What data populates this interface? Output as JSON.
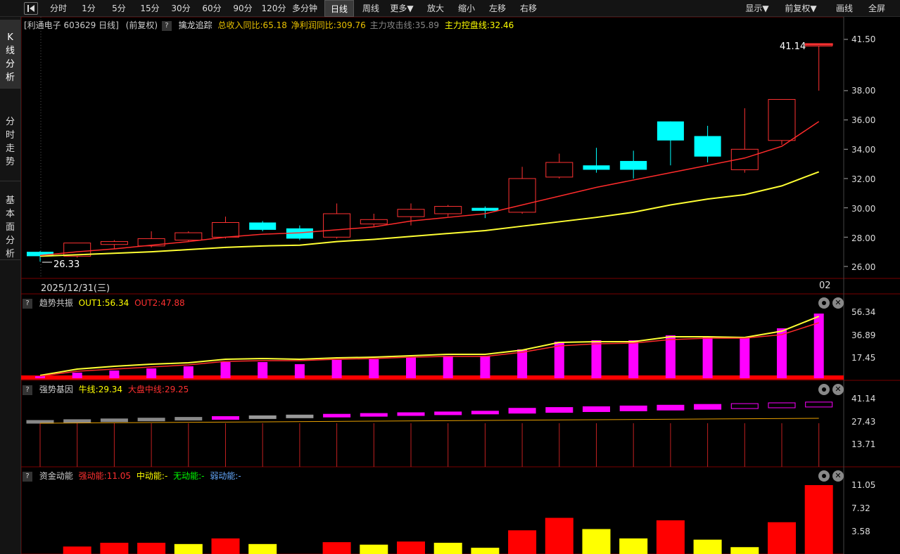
{
  "toolbar": {
    "back_icon": "back-triangle-icon",
    "periods": [
      "分时",
      "1分",
      "5分",
      "15分",
      "30分",
      "60分",
      "90分",
      "120分",
      "多分钟",
      "日线",
      "周线",
      "更多▼",
      "放大",
      "缩小",
      "左移",
      "右移"
    ],
    "active_period": "日线",
    "right_buttons": [
      "显示▼",
      "前复权▼",
      "画线",
      "全屏"
    ]
  },
  "left_tabs": [
    {
      "label": "K线分析",
      "chars": [
        "K",
        "线",
        "分",
        "析"
      ]
    },
    {
      "label": "分时走势",
      "chars": [
        "分",
        "时",
        "走",
        "势"
      ]
    },
    {
      "label": "基本面分析",
      "chars": [
        "基",
        "本",
        "面",
        "分",
        "析"
      ]
    }
  ],
  "main_panel": {
    "stock_label": "[利通电子 603629 日线]",
    "adjust_label": "(前复权)",
    "indicator_name": "擒龙追踪",
    "revenue_yoy": "总收入同比:65.18",
    "profit_yoy": "净利润同比:309.76",
    "attack_line": "主力攻击线:35.89",
    "control_line": "主力控盘线:32.46",
    "high_marker": "41.14",
    "low_marker": "26.33",
    "date_label": "2025/12/31(三)",
    "date_label_right": "02",
    "y_ticks": [
      "41.50",
      "38.00",
      "36.00",
      "34.00",
      "32.00",
      "30.00",
      "28.00",
      "26.00"
    ],
    "y_tick_values": [
      41.5,
      38,
      36,
      34,
      32,
      30,
      28,
      26
    ]
  },
  "trend_panel": {
    "name": "趋势共振",
    "out1": "OUT1:56.34",
    "out2": "OUT2:47.88",
    "y_ticks": [
      "56.34",
      "36.89",
      "17.45"
    ],
    "bars": [
      3,
      8,
      11,
      14,
      17,
      23,
      23,
      20,
      26,
      27,
      30,
      32,
      32,
      41,
      52,
      54,
      54,
      61,
      59,
      58,
      71,
      92
    ],
    "out1_line": [
      4,
      13,
      17,
      20,
      22,
      27,
      28,
      27,
      29,
      30,
      32,
      34,
      34,
      40,
      51,
      52,
      52,
      59,
      59,
      58,
      67,
      88
    ],
    "out2_line": [
      3,
      10,
      13,
      16,
      19,
      24,
      25,
      25,
      27,
      28,
      30,
      31,
      31,
      37,
      46,
      49,
      50,
      55,
      57,
      57,
      62,
      79
    ],
    "bar_scale_max": 100
  },
  "strength_panel": {
    "name": "强势基因",
    "bull_line": "牛线:29.34",
    "market_line": "大盘中线:29.25",
    "y_ticks": [
      "41.14",
      "27.43",
      "13.71"
    ]
  },
  "fund_panel": {
    "name": "资金动能",
    "strong": "强动能:11.05",
    "medium": "中动能:-",
    "none": "无动能:-",
    "weak": "弱动能:-",
    "y_ticks": [
      "11.05",
      "7.32",
      "3.58"
    ],
    "bars": [
      {
        "v": 1.2,
        "c": "red"
      },
      {
        "v": 1.8,
        "c": "red"
      },
      {
        "v": 1.8,
        "c": "red"
      },
      {
        "v": 1.6,
        "c": "yellow"
      },
      {
        "v": 2.5,
        "c": "red"
      },
      {
        "v": 1.6,
        "c": "yellow"
      },
      {
        "v": 0,
        "c": "none"
      },
      {
        "v": 1.9,
        "c": "red"
      },
      {
        "v": 1.5,
        "c": "yellow"
      },
      {
        "v": 2.0,
        "c": "red"
      },
      {
        "v": 1.8,
        "c": "yellow"
      },
      {
        "v": 1.0,
        "c": "yellow"
      },
      {
        "v": 3.8,
        "c": "red"
      },
      {
        "v": 5.8,
        "c": "red"
      },
      {
        "v": 4.0,
        "c": "yellow"
      },
      {
        "v": 2.5,
        "c": "yellow"
      },
      {
        "v": 5.4,
        "c": "red"
      },
      {
        "v": 2.3,
        "c": "yellow"
      },
      {
        "v": 1.1,
        "c": "yellow"
      },
      {
        "v": 5.1,
        "c": "red"
      },
      {
        "v": 11.05,
        "c": "red"
      }
    ]
  },
  "candles": [
    {
      "o": 26.7,
      "c": 27.0,
      "h": 27.05,
      "l": 26.33,
      "up": false
    },
    {
      "o": 26.7,
      "c": 27.6,
      "h": 27.6,
      "l": 26.6,
      "up": true
    },
    {
      "o": 27.5,
      "c": 27.7,
      "h": 27.8,
      "l": 27.2,
      "up": true
    },
    {
      "o": 27.4,
      "c": 27.9,
      "h": 28.4,
      "l": 27.3,
      "up": true
    },
    {
      "o": 27.8,
      "c": 28.3,
      "h": 28.4,
      "l": 27.7,
      "up": true
    },
    {
      "o": 28.0,
      "c": 29.0,
      "h": 29.4,
      "l": 27.9,
      "up": true
    },
    {
      "o": 29.0,
      "c": 28.5,
      "h": 29.1,
      "l": 28.4,
      "up": false
    },
    {
      "o": 28.6,
      "c": 27.9,
      "h": 28.8,
      "l": 27.8,
      "up": false
    },
    {
      "o": 28.0,
      "c": 29.6,
      "h": 30.3,
      "l": 27.9,
      "up": true
    },
    {
      "o": 28.9,
      "c": 29.2,
      "h": 29.6,
      "l": 28.7,
      "up": true
    },
    {
      "o": 29.4,
      "c": 29.9,
      "h": 30.3,
      "l": 28.8,
      "up": true
    },
    {
      "o": 29.6,
      "c": 30.1,
      "h": 30.2,
      "l": 29.4,
      "up": true
    },
    {
      "o": 30.0,
      "c": 29.8,
      "h": 30.1,
      "l": 29.3,
      "up": false
    },
    {
      "o": 29.7,
      "c": 32.0,
      "h": 32.8,
      "l": 29.6,
      "up": true
    },
    {
      "o": 32.1,
      "c": 33.1,
      "h": 33.7,
      "l": 32.0,
      "up": true
    },
    {
      "o": 32.9,
      "c": 32.6,
      "h": 34.1,
      "l": 32.4,
      "up": false
    },
    {
      "o": 33.2,
      "c": 32.6,
      "h": 33.9,
      "l": 32.0,
      "up": false
    },
    {
      "o": 35.9,
      "c": 34.6,
      "h": 35.9,
      "l": 32.9,
      "up": false
    },
    {
      "o": 34.9,
      "c": 33.5,
      "h": 35.6,
      "l": 33.1,
      "up": false
    },
    {
      "o": 32.6,
      "c": 34.0,
      "h": 36.8,
      "l": 32.4,
      "up": true
    },
    {
      "o": 34.6,
      "c": 37.4,
      "h": 37.4,
      "l": 34.3,
      "up": true
    },
    {
      "o": 41.14,
      "c": 41.14,
      "h": 41.14,
      "l": 38.0,
      "up": true
    }
  ],
  "ma_red": [
    26.75,
    27.0,
    27.2,
    27.45,
    27.7,
    28.0,
    28.2,
    28.3,
    28.5,
    28.7,
    29.1,
    29.35,
    29.6,
    30.2,
    30.8,
    31.4,
    31.9,
    32.4,
    32.9,
    33.4,
    34.2,
    35.89
  ],
  "ma_yellow": [
    26.7,
    26.8,
    26.9,
    27.0,
    27.15,
    27.3,
    27.4,
    27.45,
    27.7,
    27.85,
    28.05,
    28.25,
    28.45,
    28.75,
    29.05,
    29.35,
    29.7,
    30.2,
    30.6,
    30.9,
    31.5,
    32.46
  ],
  "colors": {
    "up": "#ff3232",
    "down": "#00ffff",
    "ma_red": "#ff2b2b",
    "ma_yellow": "#ffff33",
    "magenta": "#ff00ff",
    "yellow_text": "#ffff00",
    "red_text": "#ff3030",
    "green_text": "#00ff00",
    "blue_text": "#66aaff",
    "grid": "#7a0000"
  }
}
